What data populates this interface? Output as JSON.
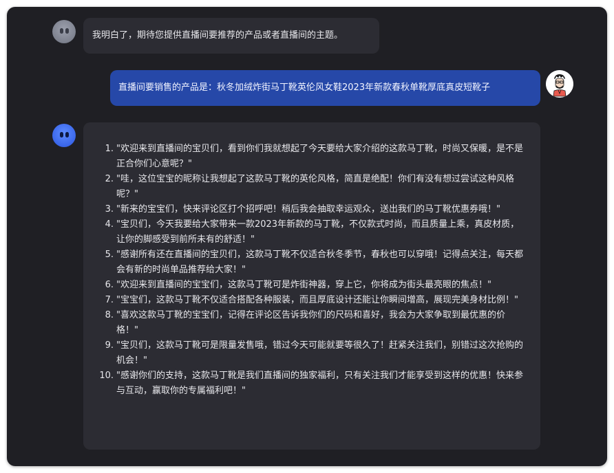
{
  "messages": {
    "first": {
      "text": "我明白了，期待您提供直播间要推荐的产品或者直播间的主题。"
    },
    "user": {
      "text": "直播间要销售的产品是：秋冬加绒炸街马丁靴英伦风女鞋2023年新款春秋单靴厚底真皮短靴子"
    },
    "reply": {
      "items": [
        {
          "num": "1.",
          "text": "\"欢迎来到直播间的宝贝们，看到你们我就想起了今天要给大家介绍的这款马丁靴，时尚又保暖，是不是正合你们心意呢？\""
        },
        {
          "num": "2.",
          "text": "\"哇，这位宝宝的昵称让我想起了这款马丁靴的英伦风格，简直是绝配！你们有没有想过尝试这种风格呢？\""
        },
        {
          "num": "3.",
          "text": "\"新来的宝宝们，快来评论区打个招呼吧！稍后我会抽取幸运观众，送出我们的马丁靴优惠券哦！\""
        },
        {
          "num": "4.",
          "text": "\"宝贝们，今天我要给大家带来一款2023年新款的马丁靴，不仅款式时尚，而且质量上乘，真皮材质，让你的脚感受到前所未有的舒适！\""
        },
        {
          "num": "5.",
          "text": "\"感谢所有还在直播间的宝贝们，这款马丁靴不仅适合秋冬季节，春秋也可以穿哦！记得点关注，每天都会有新的时尚单品推荐给大家！\""
        },
        {
          "num": "6.",
          "text": "\"欢迎来到直播间的宝宝们，这款马丁靴可是炸街神器，穿上它，你将成为街头最亮眼的焦点！\""
        },
        {
          "num": "7.",
          "text": "\"宝宝们，这款马丁靴不仅适合搭配各种服装，而且厚底设计还能让你瞬间增高，展现完美身材比例！\""
        },
        {
          "num": "8.",
          "text": "\"喜欢这款马丁靴的宝宝们，记得在评论区告诉我你们的尺码和喜好，我会为大家争取到最优惠的价格！\""
        },
        {
          "num": "9.",
          "text": "\"宝贝们，这款马丁靴可是限量发售哦，错过今天可能就要等很久了！赶紧关注我们，别错过这次抢购的机会！\""
        },
        {
          "num": "10.",
          "text": "\"感谢你们的支持，这款马丁靴是我们直播间的独家福利，只有关注我们才能享受到这样的优惠！快来参与互动，赢取你的专属福利吧！\""
        }
      ]
    }
  },
  "icons": {
    "bot_avatar_first": "bot-avatar-icon",
    "bot_avatar_reply": "bot-avatar-icon",
    "user_avatar": "user-avatar-icon"
  },
  "colors": {
    "background": "#1f1f24",
    "bot_bubble": "#2c2c33",
    "user_bubble": "#2648a8",
    "bot_avatar_blue": "#3a66ea",
    "bot_avatar_gray": "#7d818e"
  }
}
